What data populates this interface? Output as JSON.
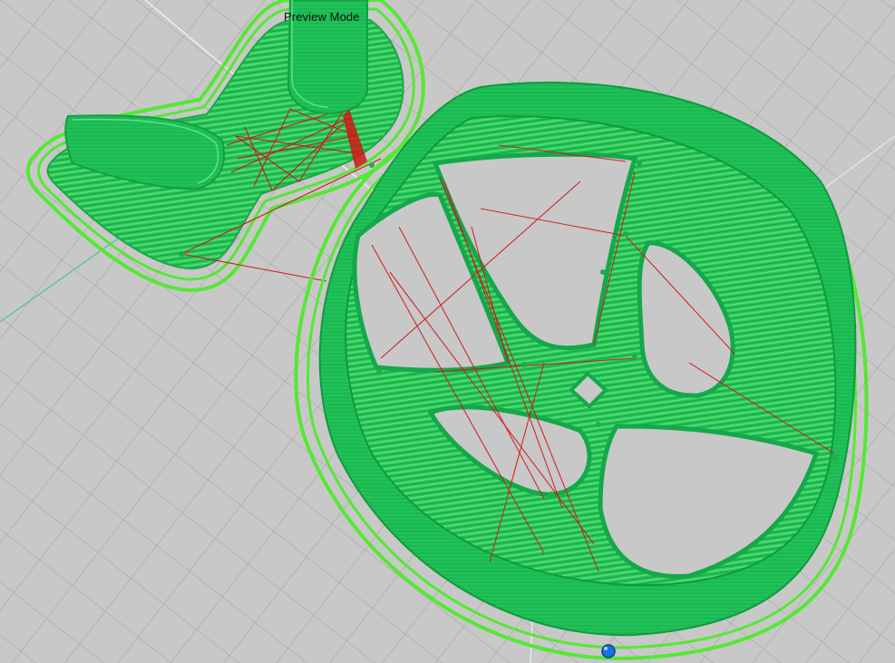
{
  "viewport": {
    "mode_label": "Preview Mode"
  },
  "colors": {
    "bed_background": "#c8c8c8",
    "grid_line": "#a9a9a9",
    "wall": "#1fc85a",
    "wall_dark": "#14a744",
    "skirt": "#55e835",
    "travel_move": "#d01818",
    "axis_line": "#ffffff",
    "axis_line_teal": "#2fbfa0",
    "nozzle_marker": "#1e6fe0"
  },
  "icons": {
    "nozzle_marker": "nozzle-position-icon"
  }
}
